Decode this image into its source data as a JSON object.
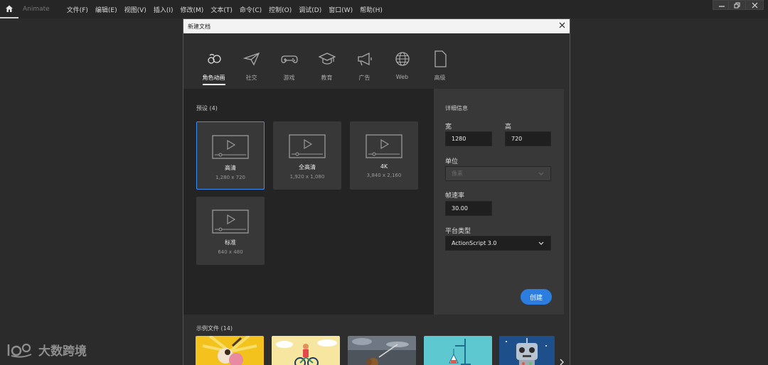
{
  "app": {
    "home_icon": "home-icon",
    "name": "Animate",
    "menu": [
      "文件(F)",
      "编辑(E)",
      "视图(V)",
      "插入(I)",
      "修改(M)",
      "文本(T)",
      "命令(C)",
      "控制(O)",
      "调试(D)",
      "窗口(W)",
      "帮助(H)"
    ],
    "window_controls": [
      "minimize-icon",
      "restore-icon",
      "close-icon"
    ]
  },
  "dialog": {
    "title": "新建文档",
    "tabs": [
      {
        "label": "角色动画",
        "icon": "character-animation-icon",
        "active": true
      },
      {
        "label": "社交",
        "icon": "paper-plane-icon"
      },
      {
        "label": "游戏",
        "icon": "gamepad-icon"
      },
      {
        "label": "教育",
        "icon": "graduation-cap-icon"
      },
      {
        "label": "广告",
        "icon": "megaphone-icon"
      },
      {
        "label": "Web",
        "icon": "globe-icon"
      },
      {
        "label": "高级",
        "icon": "document-icon"
      }
    ],
    "presets": {
      "title": "预设 (4)",
      "items": [
        {
          "name": "高清",
          "size": "1,280 x 720",
          "selected": true
        },
        {
          "name": "全高清",
          "size": "1,920 x 1,080"
        },
        {
          "name": "4K",
          "size": "3,840 x 2,160"
        },
        {
          "name": "标准",
          "size": "640 x 480"
        }
      ]
    },
    "details": {
      "title": "详细信息",
      "width_label": "宽",
      "width_value": "1280",
      "height_label": "高",
      "height_value": "720",
      "unit_label": "单位",
      "unit_value": "像素",
      "framerate_label": "帧速率",
      "framerate_value": "30.00",
      "platform_label": "平台类型",
      "platform_value": "ActionScript 3.0",
      "create_button": "创建"
    },
    "examples": {
      "title": "示例文件 (14)"
    }
  },
  "watermark": {
    "text": "大数跨境"
  },
  "colors": {
    "accent": "#2b7ee0",
    "selected_border": "#3b8ff3"
  }
}
